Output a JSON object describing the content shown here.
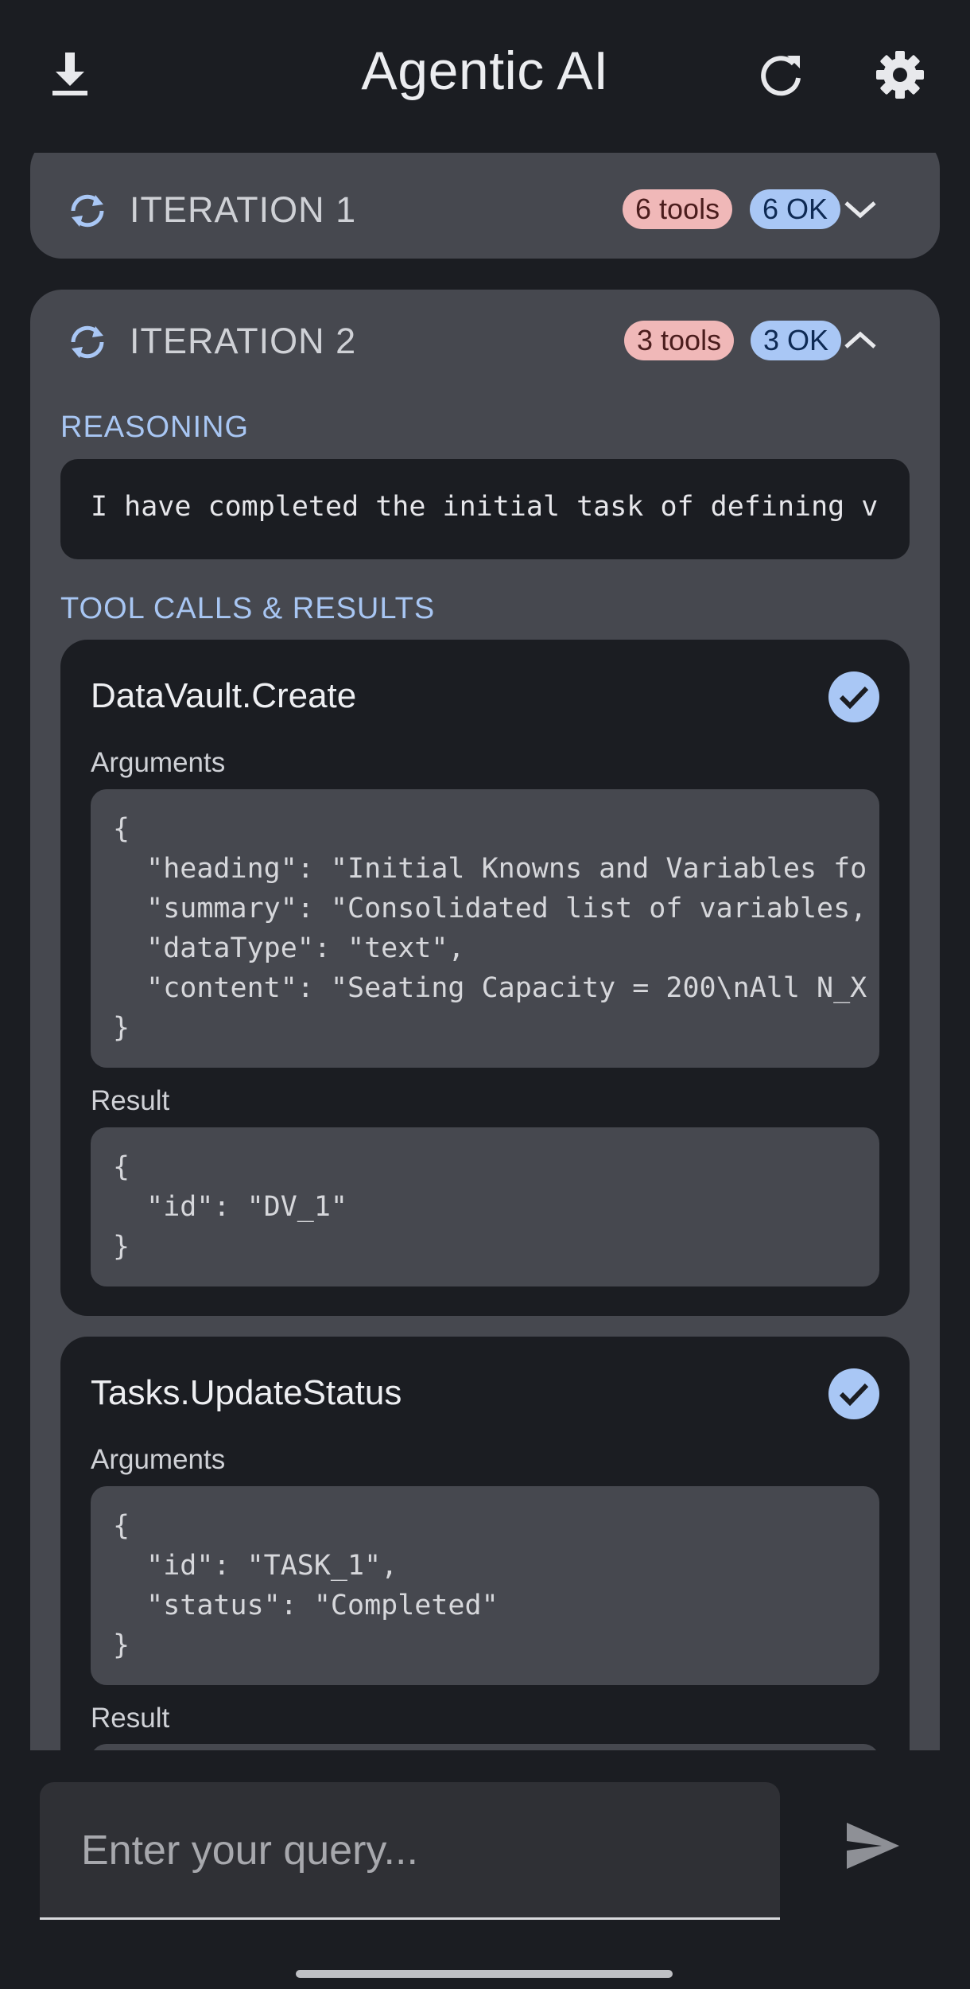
{
  "app": {
    "title": "Agentic AI"
  },
  "iterations": [
    {
      "label": "ITERATION 1",
      "tools_badge": "6 tools",
      "ok_badge": "6 OK"
    },
    {
      "label": "ITERATION 2",
      "tools_badge": "3 tools",
      "ok_badge": "3 OK",
      "reasoning_label": "REASONING",
      "reasoning_text": "I have completed the initial task of defining v",
      "tool_calls_label": "TOOL CALLS & RESULTS",
      "tool_calls": [
        {
          "name": "DataVault.Create",
          "arguments_label": "Arguments",
          "arguments_lines": [
            "{",
            "  \"heading\": \"Initial Knowns and Variables fo",
            "  \"summary\": \"Consolidated list of variables,",
            "  \"dataType\": \"text\",",
            "  \"content\": \"Seating Capacity = 200\\nAll N_X",
            "}"
          ],
          "result_label": "Result",
          "result_lines": [
            "{",
            "  \"id\": \"DV_1\"",
            "}"
          ]
        },
        {
          "name": "Tasks.UpdateStatus",
          "arguments_label": "Arguments",
          "arguments_lines": [
            "{",
            "  \"id\": \"TASK_1\",",
            "  \"status\": \"Completed\"",
            "}"
          ],
          "result_label": "Result"
        }
      ]
    }
  ],
  "query": {
    "placeholder": "Enter your query..."
  },
  "colors": {
    "accent": "#a9c7f5",
    "tools_badge": "#f0b8b8",
    "card": "#46484f",
    "background": "#1b1d22"
  }
}
